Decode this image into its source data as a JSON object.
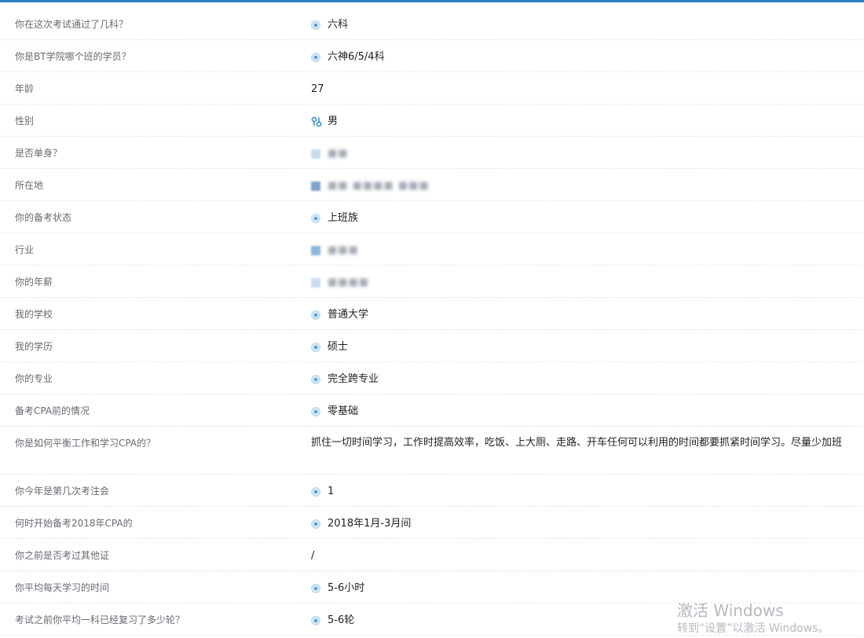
{
  "rows": [
    {
      "label": "你在这次考试通过了几科？",
      "value": "六科",
      "icon": "radio"
    },
    {
      "label": "你是BT学院哪个班的学员？",
      "value": "六神6/5/4科",
      "icon": "radio"
    },
    {
      "label": "年龄",
      "value": "27",
      "icon": "none"
    },
    {
      "label": "性别",
      "value": "男",
      "icon": "gender"
    },
    {
      "label": "是否单身？",
      "value": "■■",
      "icon": "blur"
    },
    {
      "label": "所在地",
      "value": "■■ ■■■■ ■■■",
      "icon": "blur-dark"
    },
    {
      "label": "你的备考状态",
      "value": "上班族",
      "icon": "radio"
    },
    {
      "label": "行业",
      "value": "■■■",
      "icon": "blur-square"
    },
    {
      "label": "你的年薪",
      "value": "■■■■",
      "icon": "blur"
    },
    {
      "label": "我的学校",
      "value": "普通大学",
      "icon": "radio"
    },
    {
      "label": "我的学历",
      "value": "硕士",
      "icon": "radio"
    },
    {
      "label": "你的专业",
      "value": "完全跨专业",
      "icon": "radio"
    },
    {
      "label": "备考CPA前的情况",
      "value": "零基础",
      "icon": "radio"
    },
    {
      "label": "你是如何平衡工作和学习CPA的？",
      "value": "抓住一切时间学习，工作时提高效率，吃饭、上大厕、走路、开车任何可以利用的时间都要抓紧时间学习。尽量少加班",
      "icon": "none",
      "tall": true
    },
    {
      "label": "你今年是第几次考注会",
      "value": "1",
      "icon": "radio"
    },
    {
      "label": "何时开始备考2018年CPA的",
      "value": "2018年1月-3月间",
      "icon": "radio"
    },
    {
      "label": "你之前是否考过其他证",
      "value": "/",
      "icon": "none"
    },
    {
      "label": "你平均每天学习的时间",
      "value": "5-6小时",
      "icon": "radio"
    },
    {
      "label": "考试之前你平均一科已经复习了多少轮？",
      "value": "5-6轮",
      "icon": "radio"
    }
  ],
  "watermark": {
    "line1": "激活 Windows",
    "line2": "转到“设置”以激活 Windows。"
  },
  "colors": {
    "accent": "#2f7fc4",
    "radio_dot": "#4a9ad6",
    "label_text": "#666a70",
    "value_text": "#222222"
  }
}
